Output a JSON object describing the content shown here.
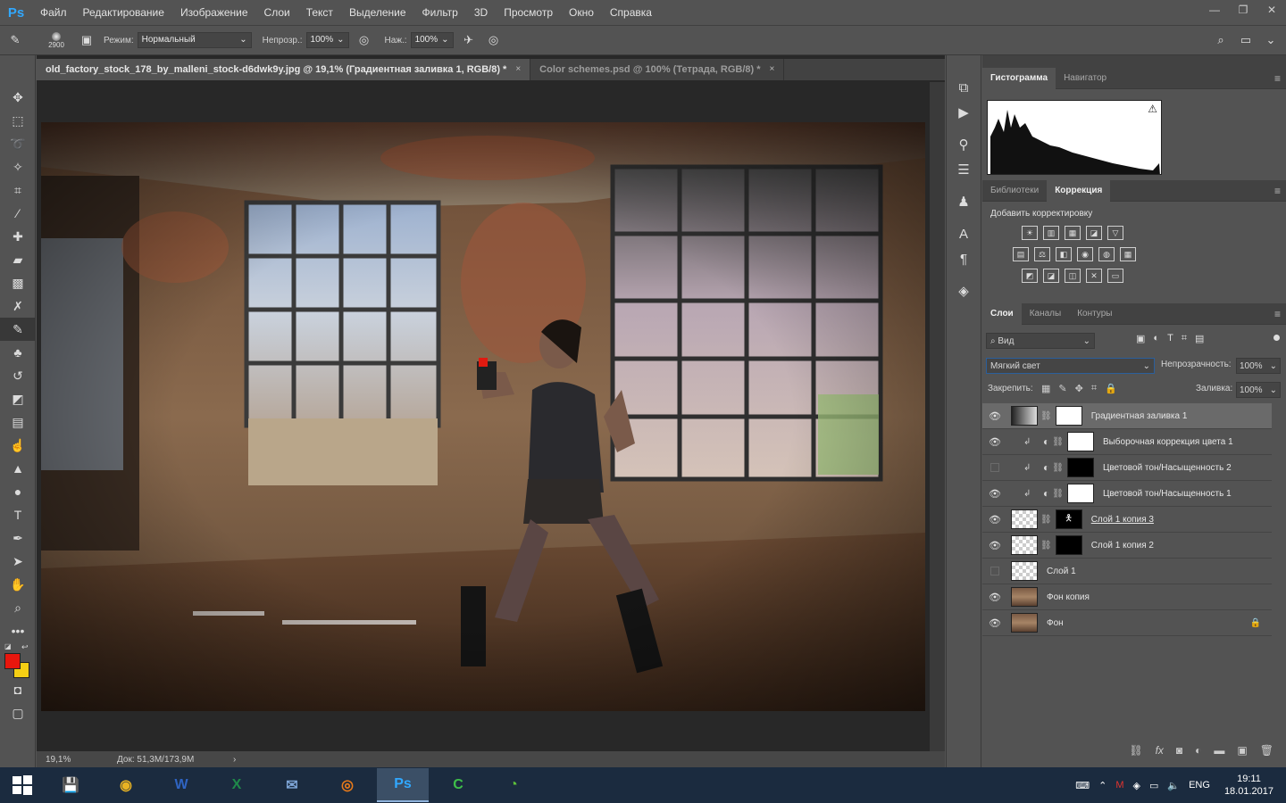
{
  "app": {
    "logo": "Ps"
  },
  "menu": [
    "Файл",
    "Редактирование",
    "Изображение",
    "Слои",
    "Текст",
    "Выделение",
    "Фильтр",
    "3D",
    "Просмотр",
    "Окно",
    "Справка"
  ],
  "window_controls": {
    "minimize": "—",
    "restore": "❐",
    "close": "✕"
  },
  "options": {
    "brush_size": "2900",
    "mode_label": "Режим:",
    "mode_value": "Нормальный",
    "opacity_label": "Непрозр.:",
    "opacity_value": "100%",
    "pressure_label": "Наж.:",
    "pressure_value": "100%"
  },
  "tabs": [
    {
      "title": "old_factory_stock_178_by_malleni_stock-d6dwk9y.jpg @ 19,1% (Градиентная заливка 1, RGB/8) *",
      "close": "×"
    },
    {
      "title": "Color schemes.psd @ 100% (Тетрада, RGB/8) *",
      "close": "×"
    }
  ],
  "status": {
    "zoom": "19,1%",
    "doc": "Док: 51,3M/173,9M",
    "arrow": "›"
  },
  "colors": {
    "foreground": "#e8160d",
    "background": "#f5cf14",
    "accent": "#31a8ff"
  },
  "histogram_panel": {
    "tabs": [
      "Гистограмма",
      "Навигатор"
    ],
    "warning": "⚠"
  },
  "adjust_panel": {
    "tabs": [
      "Библиотеки",
      "Коррекция"
    ],
    "title": "Добавить корректировку",
    "icons_row1": [
      "☀",
      "▥",
      "▦",
      "◪",
      "▽"
    ],
    "icons_row2": [
      "▤",
      "⚖",
      "◧",
      "◉",
      "◍",
      "▦"
    ],
    "icons_row3": [
      "◩",
      "◪",
      "◫",
      "✕",
      "▭"
    ]
  },
  "layers_panel": {
    "tabs": [
      "Слои",
      "Каналы",
      "Контуры"
    ],
    "filter_label": "Вид",
    "blend_mode": "Мягкий свет",
    "opacity_label": "Непрозрачность:",
    "opacity_value": "100%",
    "lock_label": "Закрепить:",
    "fill_label": "Заливка:",
    "fill_value": "100%",
    "layers": [
      {
        "name": "Градиентная заливка 1",
        "visible": true,
        "kind": "gradient",
        "selected": true
      },
      {
        "name": "Выборочная коррекция цвета 1",
        "visible": true,
        "kind": "adjust",
        "mask": "white"
      },
      {
        "name": "Цветовой тон/Насыщенность 2",
        "visible": false,
        "kind": "adjust",
        "mask": "black"
      },
      {
        "name": "Цветовой тон/Насыщенность 1",
        "visible": true,
        "kind": "adjust",
        "mask": "white"
      },
      {
        "name": "Слой 1 копия 3",
        "visible": true,
        "kind": "pixel-mask"
      },
      {
        "name": "Слой 1 копия 2",
        "visible": true,
        "kind": "pixel-mask"
      },
      {
        "name": "Слой 1",
        "visible": false,
        "kind": "pixel"
      },
      {
        "name": "Фон копия",
        "visible": true,
        "kind": "photo"
      },
      {
        "name": "Фон",
        "visible": true,
        "kind": "photo-locked"
      }
    ],
    "footer_icons": [
      "⛓",
      "fx",
      "◙",
      "◐",
      "▬",
      "▣",
      "🗑"
    ]
  },
  "taskbar": {
    "apps": [
      "💾",
      "◉",
      "W",
      "X",
      "✉",
      "◎",
      "Ps",
      "C",
      "◔"
    ],
    "lang": "ENG",
    "time": "19:11",
    "date": "18.01.2017"
  }
}
